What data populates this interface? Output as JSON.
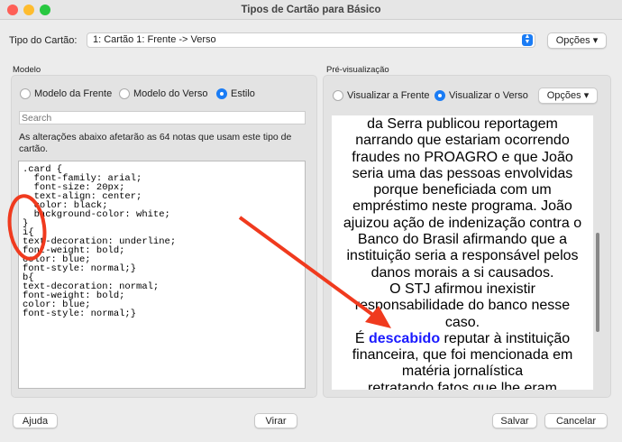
{
  "window": {
    "title": "Tipos de Cartão para Básico"
  },
  "card_type": {
    "label": "Tipo do Cartão:",
    "value": "1: Cartão 1: Frente -> Verso",
    "options_button": "Opções ▾"
  },
  "model": {
    "title": "Modelo",
    "radios": [
      {
        "label": "Modelo da Frente",
        "selected": false
      },
      {
        "label": "Modelo do Verso",
        "selected": false
      },
      {
        "label": "Estilo",
        "selected": true
      }
    ],
    "search_placeholder": "Search",
    "notice": "As alterações abaixo afetarão as 64 notas que usam este tipo de cartão.",
    "css": ".card {\n  font-family: arial;\n  font-size: 20px;\n  text-align: center;\n  color: black;\n  background-color: white;\n}\ni{\ntext-decoration: underline;\nfont-weight: bold;\ncolor: blue;\nfont-style: normal;}\nb{\ntext-decoration: normal;\nfont-weight: bold;\ncolor: blue;\nfont-style: normal;}"
  },
  "preview": {
    "title": "Pré-visualização",
    "radios": [
      {
        "label": "Visualizar a Frente",
        "selected": false
      },
      {
        "label": "Visualizar o Verso",
        "selected": true
      }
    ],
    "options_button": "Opções ▾",
    "lines": [
      "da Serra publicou reportagem",
      "narrando que estariam ocorrendo",
      "fraudes no PROAGRO e que João",
      "seria uma das pessoas envolvidas",
      "porque beneficiada com um",
      "empréstimo neste programa. João",
      "ajuizou ação de indenização contra o",
      "Banco do Brasil afirmando que a",
      "instituição seria a responsável pelos",
      "danos morais a si causados.",
      "O STJ afirmou inexistir",
      "responsabilidade do banco nesse",
      "caso."
    ],
    "bold_prefix": "É ",
    "bold_word": "descabido",
    "bold_suffix": " reputar à instituição",
    "lines_after": [
      "financeira, que foi mencionada em",
      "matéria jornalística",
      "retratando fatos que lhe eram"
    ]
  },
  "buttons": {
    "help": "Ajuda",
    "flip": "Virar",
    "save": "Salvar",
    "cancel": "Cancelar"
  },
  "colors": {
    "accent": "#1a7cf5",
    "annotation": "#f03a1e",
    "bold_text": "#1a1aff"
  }
}
